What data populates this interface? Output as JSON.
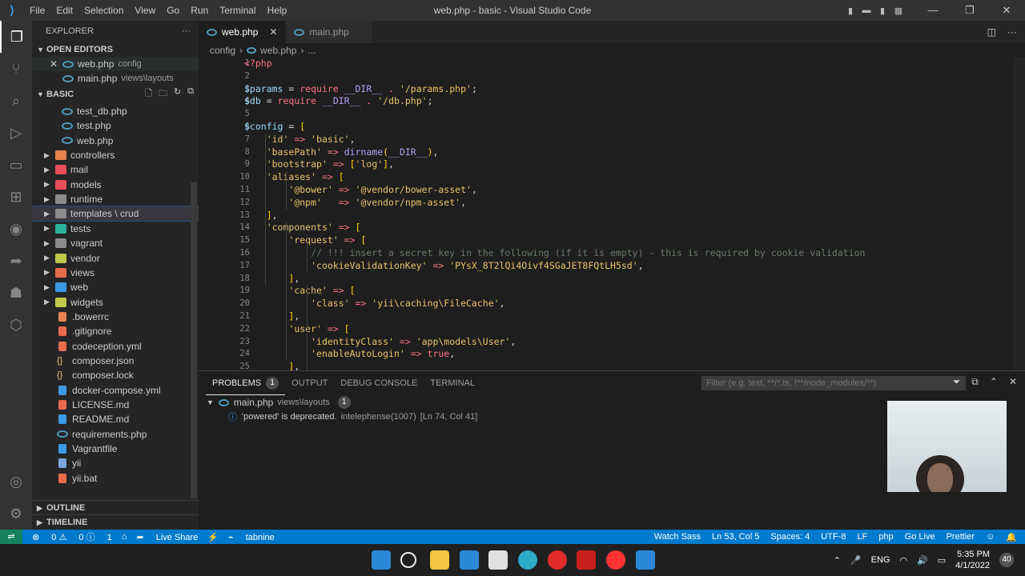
{
  "titlebar": {
    "menu": [
      "File",
      "Edit",
      "Selection",
      "View",
      "Go",
      "Run",
      "Terminal",
      "Help"
    ],
    "title": "web.php - basic - Visual Studio Code"
  },
  "sidebar": {
    "header": "EXPLORER",
    "open_editors_label": "OPEN EDITORS",
    "open_editors": [
      {
        "name": "web.php",
        "desc": "config"
      },
      {
        "name": "main.php",
        "desc": "views\\layouts"
      }
    ],
    "project_label": "BASIC",
    "files": [
      {
        "name": "test_db.php",
        "type": "php",
        "depth": 2
      },
      {
        "name": "test.php",
        "type": "php",
        "depth": 2
      },
      {
        "name": "web.php",
        "type": "php",
        "depth": 2
      },
      {
        "name": "controllers",
        "type": "folder",
        "color": "#e8834e"
      },
      {
        "name": "mail",
        "type": "folder",
        "color": "#e84e5a"
      },
      {
        "name": "models",
        "type": "folder",
        "color": "#e84e5a"
      },
      {
        "name": "runtime",
        "type": "folder",
        "color": "#8b8b8b"
      },
      {
        "name": "templates \\ crud",
        "type": "folder",
        "color": "#8b8b8b"
      },
      {
        "name": "tests",
        "type": "folder",
        "color": "#2bb39a"
      },
      {
        "name": "vagrant",
        "type": "folder",
        "color": "#8b8b8b"
      },
      {
        "name": "vendor",
        "type": "folder",
        "color": "#c2c84a"
      },
      {
        "name": "views",
        "type": "folder",
        "color": "#e86b4e"
      },
      {
        "name": "web",
        "type": "folder",
        "color": "#3b9ae8"
      },
      {
        "name": "widgets",
        "type": "folder",
        "color": "#c2c84a"
      },
      {
        "name": ".bowerrc",
        "type": "file",
        "color": "#e8834e"
      },
      {
        "name": ".gitignore",
        "type": "file",
        "color": "#e86b4e"
      },
      {
        "name": "codeception.yml",
        "type": "file",
        "color": "#e86b4e"
      },
      {
        "name": "composer.json",
        "type": "braces",
        "color": "#e9c46a"
      },
      {
        "name": "composer.lock",
        "type": "braces",
        "color": "#e9c46a"
      },
      {
        "name": "docker-compose.yml",
        "type": "file",
        "color": "#3b9ae8"
      },
      {
        "name": "LICENSE.md",
        "type": "file",
        "color": "#e86b4e"
      },
      {
        "name": "README.md",
        "type": "file",
        "color": "#3b9ae8"
      },
      {
        "name": "requirements.php",
        "type": "php",
        "depth": 1
      },
      {
        "name": "Vagrantfile",
        "type": "file",
        "color": "#3b9ae8"
      },
      {
        "name": "yii",
        "type": "file",
        "color": "#7aa7d8"
      },
      {
        "name": "yii.bat",
        "type": "file",
        "color": "#e86b4e"
      }
    ],
    "outline_label": "OUTLINE",
    "timeline_label": "TIMELINE"
  },
  "tabs": [
    {
      "label": "web.php",
      "active": true
    },
    {
      "label": "main.php",
      "active": false
    }
  ],
  "breadcrumb": [
    "config",
    "web.php",
    "..."
  ],
  "code_lines": [
    "1",
    "2",
    "3",
    "4",
    "5",
    "6",
    "7",
    "8",
    "9",
    "10",
    "11",
    "12",
    "13",
    "14",
    "15",
    "16",
    "17",
    "18",
    "19",
    "20",
    "21",
    "22",
    "23",
    "24",
    "25"
  ],
  "code": [
    "<?php",
    "",
    "$params = require __DIR__ . '/params.php';",
    "$db = require __DIR__ . '/db.php';",
    "",
    "$config = [",
    "    'id' => 'basic',",
    "    'basePath' => dirname(__DIR__),",
    "    'bootstrap' => ['log'],",
    "    'aliases' => [",
    "        '@bower' => '@vendor/bower-asset',",
    "        '@npm'   => '@vendor/npm-asset',",
    "    ],",
    "    'components' => [",
    "        'request' => [",
    "            // !!! insert a secret key in the following (if it is empty) - this is required by cookie validation",
    "            'cookieValidationKey' => 'PYsX_8T2lQi4Oivf4SGaJET8FQtLH5sd',",
    "        ],",
    "        'cache' => [",
    "            'class' => 'yii\\caching\\FileCache',",
    "        ],",
    "        'user' => [",
    "            'identityClass' => 'app\\models\\User',",
    "            'enableAutoLogin' => true,",
    "        ],"
  ],
  "panel": {
    "tabs": [
      "PROBLEMS",
      "OUTPUT",
      "DEBUG CONSOLE",
      "TERMINAL"
    ],
    "problems_count": "1",
    "filter_placeholder": "Filter (e.g. text, **/*.ts, !**/node_modules/**)",
    "file": "main.php",
    "file_desc": "views\\layouts",
    "file_count": "1",
    "message": "'powered' is deprecated.",
    "source": "intelephense(1007)",
    "location": "[Ln 74, Col 41]"
  },
  "status": {
    "errors": "0",
    "warnings": "0",
    "info": "1",
    "live_share": "Live Share",
    "tabnine": "tabnine",
    "right": [
      "Watch Sass",
      "Ln 53, Col 5",
      "Spaces: 4",
      "UTF-8",
      "LF",
      "php",
      "Go Live",
      "Prettier"
    ]
  },
  "taskbar": {
    "lang": "ENG",
    "time": "5:35 PM",
    "date": "4/1/2022",
    "notif": "40"
  },
  "colors": {
    "accent": "#007acc",
    "php_icon": "#519aba"
  }
}
